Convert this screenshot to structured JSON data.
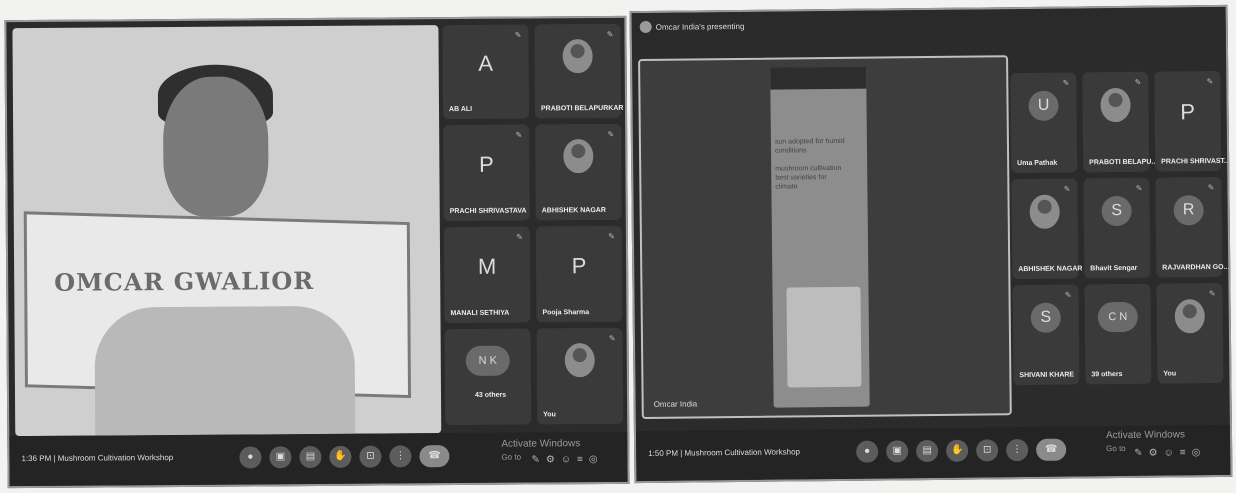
{
  "left": {
    "banner_text": "OMCAR        GWALIOR",
    "participants": [
      {
        "name": "AB ALI",
        "initial": "A"
      },
      {
        "name": "PRABOTI BELAPURKAR",
        "initial": ""
      },
      {
        "name": "PRACHI SHRIVASTAVA",
        "initial": "P"
      },
      {
        "name": "ABHISHEK NAGAR",
        "initial": ""
      },
      {
        "name": "MANALI SETHIYA",
        "initial": "M"
      },
      {
        "name": "Pooja Sharma",
        "initial": "P"
      },
      {
        "name": "43 others",
        "initial": "N K"
      },
      {
        "name": "You",
        "initial": ""
      }
    ],
    "meeting_info": "1:36 PM  |  Mushroom Cultivation Workshop",
    "watermark": "Activate Windows",
    "watermark_sub": "Go to"
  },
  "right": {
    "presenter_text": "Omcar India's presenting",
    "share_label": "Omcar India",
    "phone_text": "sun adopted for humid\nconditions\n\nmushroom cultivation\nbest varieties for\nclimate",
    "participants": [
      {
        "name": "Uma Pathak",
        "initial": "U"
      },
      {
        "name": "PRABOTI BELAPU...",
        "initial": ""
      },
      {
        "name": "PRACHI SHRIVAST...",
        "initial": "P"
      },
      {
        "name": "ABHISHEK NAGAR",
        "initial": ""
      },
      {
        "name": "Bhavit Sengar",
        "initial": "S"
      },
      {
        "name": "RAJVARDHAN GO...",
        "initial": "R"
      },
      {
        "name": "SHIVANI KHARE",
        "initial": "S"
      },
      {
        "name": "39 others",
        "initial": "C N"
      },
      {
        "name": "You",
        "initial": ""
      }
    ],
    "meeting_info": "1:50 PM  |  Mushroom Cultivation Workshop",
    "watermark": "Activate Windows",
    "watermark_sub": "Go to"
  }
}
